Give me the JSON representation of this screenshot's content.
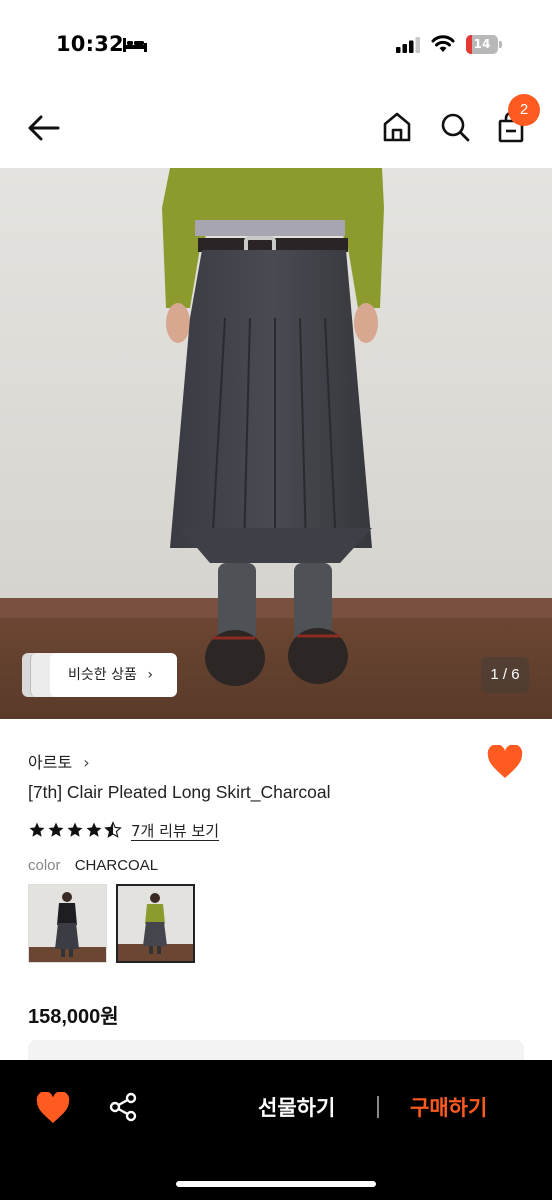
{
  "status_bar": {
    "time": "10:32",
    "battery": "14"
  },
  "header": {
    "cart_count": "2"
  },
  "image": {
    "similar_label": "비슷한 상품",
    "counter": "1 / 6"
  },
  "product": {
    "brand": "아르토",
    "title": "[7th] Clair Pleated Long Skirt_Charcoal",
    "rating": 4.5,
    "review_link": "7개 리뷰 보기",
    "color_label": "color",
    "color_value": "CHARCOAL",
    "price": "158,000원"
  },
  "bottom_bar": {
    "gift_label": "선물하기",
    "buy_label": "구매하기"
  },
  "colors": {
    "accent": "#ff5a1f",
    "like": "#ff5a1f",
    "bar_bg": "#000000"
  },
  "icons": [
    "bed-icon",
    "signal-icon",
    "wifi-icon",
    "back-arrow-icon",
    "home-icon",
    "search-icon",
    "cart-icon",
    "heart-icon",
    "share-icon",
    "star-icon",
    "chevron-right-icon"
  ]
}
